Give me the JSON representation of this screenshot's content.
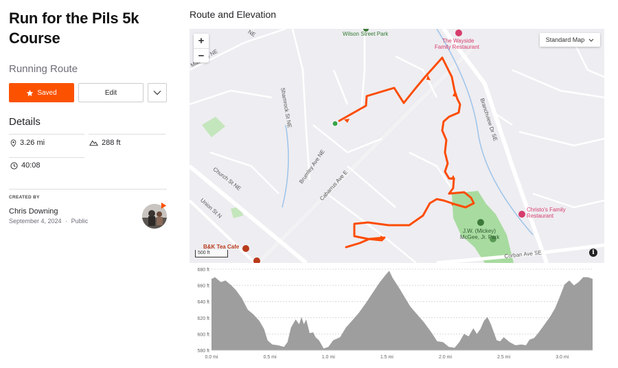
{
  "route": {
    "title_line1": "Run for the Pils 5k",
    "title_line2": "Course",
    "type": "Running Route"
  },
  "actions": {
    "saved_label": "Saved",
    "edit_label": "Edit"
  },
  "details": {
    "heading": "Details",
    "distance": "3.26 mi",
    "elevation_gain": "288 ft",
    "time": "40:08"
  },
  "creator": {
    "label": "CREATED BY",
    "name": "Chris Downing",
    "date": "September 4, 2024",
    "visibility": "Public",
    "separator": "·"
  },
  "map": {
    "section_title": "Route and Elevation",
    "zoom_in": "+",
    "zoom_out": "−",
    "map_type": "Standard Map",
    "scale": "500 ft",
    "info": "i",
    "labels": {
      "wilson_park": "Wilson Street Park",
      "wayside_1": "The Wayside",
      "wayside_2": "Family Restaurant",
      "christos_1": "Christo's Family",
      "christos_2": "Restaurant",
      "mcgee_1": "J.W. (Mickey)",
      "mcgee_2": "McGee, Jr. Park",
      "tea_cafe": "B&K Tea Cafe",
      "shamrock": "Shamrock St NE",
      "branchview": "Branchview Dr SE",
      "church": "Church St NE",
      "union": "Union St N",
      "brumley": "Brumley Ave NE",
      "cabarrus": "Cabarrus Ave E",
      "corban": "Corban Ave SE",
      "ne_top": "NE",
      "mac_ave": "Mac Ave NE"
    },
    "colors": {
      "route": "#fc4c02",
      "park": "#a8dba0",
      "road": "#ffffff",
      "background": "#eeedf1",
      "poi": "#d63c6b"
    }
  },
  "chart_data": {
    "type": "area",
    "title": "",
    "xlabel": "",
    "ylabel": "",
    "x_unit": "mi",
    "y_unit": "ft",
    "xlim": [
      0,
      3.26
    ],
    "ylim": [
      580,
      680
    ],
    "x_ticks": [
      "0.0 mi",
      "0.5 mi",
      "1.0 mi",
      "1.5 mi",
      "2.0 mi",
      "2.5 mi",
      "3.0 mi"
    ],
    "x_tick_values": [
      0,
      0.5,
      1.0,
      1.5,
      2.0,
      2.5,
      3.0
    ],
    "y_ticks": [
      "580 ft",
      "600 ft",
      "620 ft",
      "640 ft",
      "660 ft",
      "680 ft"
    ],
    "y_tick_values": [
      580,
      600,
      620,
      640,
      660,
      680
    ],
    "grid": true,
    "fill_color": "#9e9e9e",
    "x": [
      0.0,
      0.03,
      0.08,
      0.12,
      0.17,
      0.21,
      0.26,
      0.31,
      0.36,
      0.41,
      0.45,
      0.48,
      0.52,
      0.57,
      0.62,
      0.65,
      0.68,
      0.72,
      0.75,
      0.77,
      0.79,
      0.81,
      0.84,
      0.87,
      0.89,
      0.92,
      0.96,
      1.0,
      1.04,
      1.1,
      1.15,
      1.2,
      1.26,
      1.32,
      1.38,
      1.44,
      1.49,
      1.52,
      1.55,
      1.6,
      1.65,
      1.7,
      1.76,
      1.82,
      1.88,
      1.93,
      1.98,
      2.03,
      2.08,
      2.12,
      2.16,
      2.2,
      2.24,
      2.27,
      2.3,
      2.33,
      2.36,
      2.39,
      2.42,
      2.44,
      2.47,
      2.5,
      2.55,
      2.6,
      2.65,
      2.69,
      2.72,
      2.76,
      2.8,
      2.85,
      2.9,
      2.94,
      2.98,
      3.02,
      3.06,
      3.1,
      3.14,
      3.18,
      3.22,
      3.26
    ],
    "y": [
      668,
      670,
      664,
      666,
      660,
      654,
      644,
      630,
      624,
      616,
      606,
      592,
      587,
      586,
      584,
      590,
      608,
      618,
      612,
      621,
      612,
      618,
      601,
      602,
      596,
      592,
      582,
      584,
      592,
      596,
      608,
      616,
      626,
      638,
      651,
      664,
      673,
      678,
      669,
      658,
      646,
      634,
      624,
      614,
      602,
      591,
      590,
      584,
      583,
      590,
      600,
      597,
      607,
      600,
      606,
      616,
      621,
      612,
      600,
      592,
      591,
      596,
      590,
      586,
      587,
      586,
      593,
      595,
      602,
      612,
      622,
      632,
      646,
      661,
      666,
      660,
      664,
      670,
      670,
      668
    ]
  }
}
